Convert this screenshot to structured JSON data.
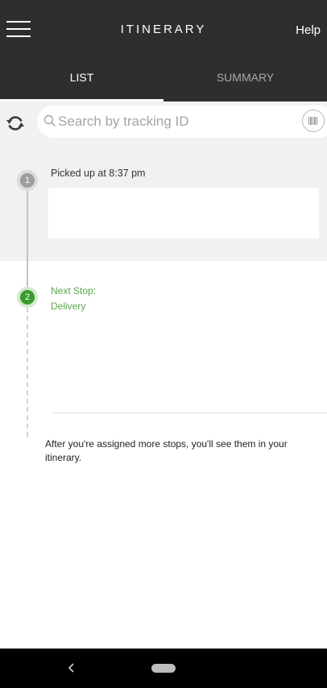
{
  "header": {
    "title": "ITINERARY",
    "help_label": "Help",
    "menu_icon": "hamburger-menu-icon"
  },
  "tabs": [
    {
      "label": "LIST",
      "active": true
    },
    {
      "label": "SUMMARY",
      "active": false
    }
  ],
  "search": {
    "placeholder": "Search by tracking ID",
    "value": "",
    "refresh_icon": "refresh-icon",
    "search_icon": "search-icon",
    "barcode_icon": "barcode-scan-icon"
  },
  "stops": [
    {
      "number": "1",
      "text": "Picked up at 8:37 pm",
      "status": "completed",
      "color": "#9e9e9e"
    },
    {
      "number": "2",
      "title": "Next Stop:",
      "subtitle": "Delivery",
      "status": "next",
      "color": "#3b9a2d"
    }
  ],
  "info_text": "After you're assigned more stops, you'll see them in your itinerary.",
  "colors": {
    "header_bg": "#2f2e2e",
    "accent_green": "#5aa54b",
    "section_gray": "#f1f1f1"
  },
  "system_nav": {
    "back_icon": "back-chevron-icon",
    "home_icon": "home-pill-icon"
  }
}
